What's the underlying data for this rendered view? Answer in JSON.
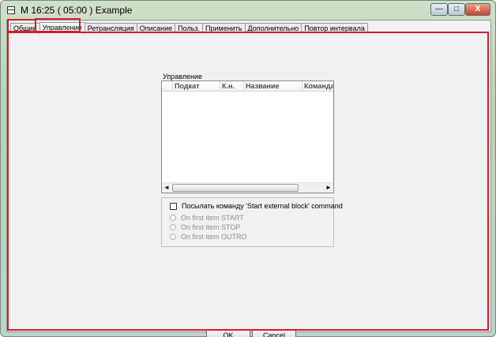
{
  "window": {
    "title": "M 16:25 ( 05:00 ) Example",
    "controls": {
      "minimize": "—",
      "maximize": "□",
      "close": "X"
    }
  },
  "tabs": [
    {
      "label": "Общие"
    },
    {
      "label": "Управление",
      "active": true
    },
    {
      "label": "Ретрансляция"
    },
    {
      "label": "Описание"
    },
    {
      "label": "Польз."
    },
    {
      "label": "Применить"
    },
    {
      "label": "Дополнительно"
    },
    {
      "label": "Повтор интервала"
    }
  ],
  "control": {
    "group_label": "Управление",
    "columns": [
      "",
      "Подкат",
      "К.н.",
      "Название",
      "Команда"
    ],
    "rows": [],
    "scrollbar": {
      "left": "◄",
      "right": "►"
    }
  },
  "options": {
    "send_command": {
      "label": "Посылать команду 'Start external block' command",
      "checked": false
    },
    "radios": [
      {
        "label": "On first item START",
        "enabled": false
      },
      {
        "label": "On first item STOP",
        "enabled": false
      },
      {
        "label": "On first item OUTRO",
        "enabled": false
      }
    ]
  },
  "buttons": {
    "ok": "OK",
    "cancel": "Cancel"
  },
  "colors": {
    "highlight": "#d81b2a",
    "panel_bg": "#f0f0f0"
  }
}
